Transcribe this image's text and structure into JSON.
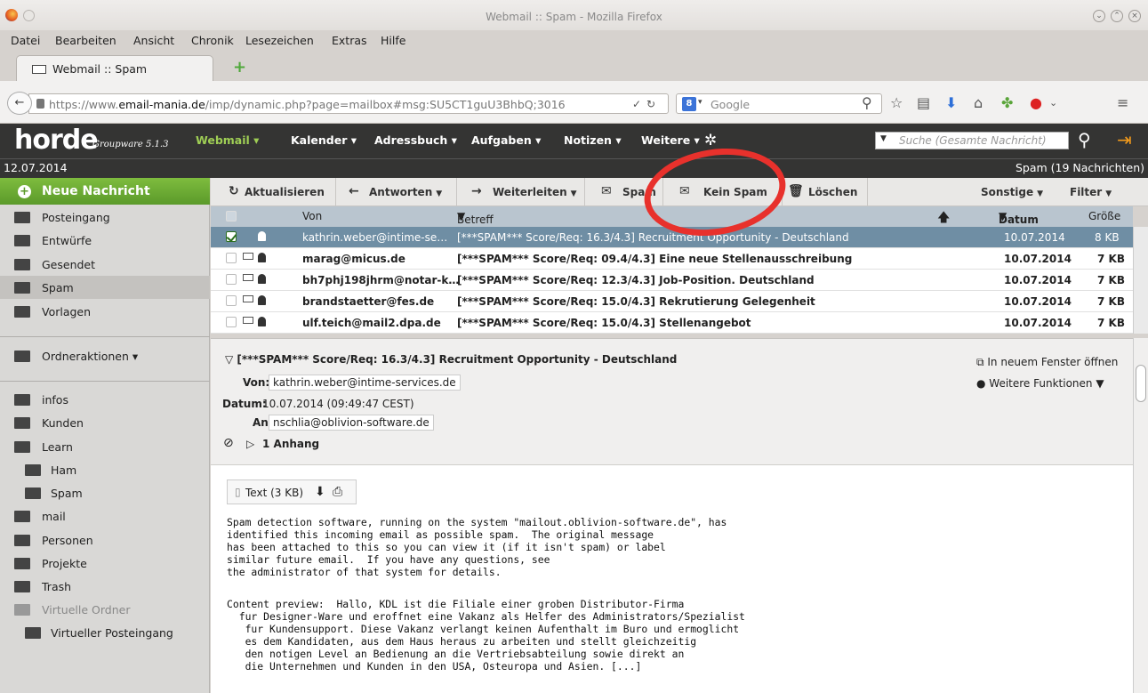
{
  "window": {
    "title": "Webmail :: Spam - Mozilla Firefox"
  },
  "menu": [
    "Datei",
    "Bearbeiten",
    "Ansicht",
    "Chronik",
    "Lesezeichen",
    "Extras",
    "Hilfe"
  ],
  "tab": {
    "label": "Webmail :: Spam"
  },
  "nav": {
    "url_prefix": "https://www.",
    "url_domain": "email-mania.de",
    "url_rest": "/imp/dynamic.php?page=mailbox#msg:SU5CT1guU3BhbQ;3016",
    "search_engine_placeholder": "Google"
  },
  "horde": {
    "logo": "horde",
    "version": "Groupware 5.1.3",
    "nav": [
      "Webmail",
      "Kalender",
      "Adressbuch",
      "Aufgaben",
      "Notizen",
      "Weitere"
    ],
    "search_placeholder": "Suche (Gesamte Nachricht)",
    "date": "12.07.2014",
    "folder_status": "Spam (19 Nachrichten)"
  },
  "sidebar": {
    "new_message": "Neue Nachricht",
    "folders": [
      "Posteingang",
      "Entwürfe",
      "Gesendet",
      "Spam",
      "Vorlagen"
    ],
    "folder_actions": "Ordneraktionen",
    "other_folders": [
      "infos",
      "Kunden",
      "Learn",
      "Ham",
      "Spam",
      "mail",
      "Personen",
      "Projekte",
      "Trash"
    ],
    "virtual_header": "Virtuelle Ordner",
    "virtual_inbox": "Virtueller Posteingang",
    "selected": "Spam"
  },
  "toolbar": {
    "refresh": "Aktualisieren",
    "reply": "Antworten",
    "forward": "Weiterleiten",
    "spam": "Spam",
    "not_spam": "Kein Spam",
    "delete": "Löschen",
    "other": "Sonstige",
    "filter": "Filter"
  },
  "list": {
    "headers": {
      "from": "Von",
      "subject": "Betreff",
      "date": "Datum",
      "size": "Größe"
    },
    "rows": [
      {
        "from": "kathrin.weber@intime-se…",
        "subject": "[***SPAM*** Score/Req: 16.3/4.3] Recruitment Opportunity - Deutschland",
        "date": "10.07.2014",
        "size": "8 KB"
      },
      {
        "from": "marag@micus.de",
        "subject": "[***SPAM*** Score/Req: 09.4/4.3] Eine neue Stellenausschreibung",
        "date": "10.07.2014",
        "size": "7 KB"
      },
      {
        "from": "bh7phj198jhrm@notar-k…",
        "subject": "[***SPAM*** Score/Req: 12.3/4.3] Job-Position. Deutschland",
        "date": "10.07.2014",
        "size": "7 KB"
      },
      {
        "from": "brandstaetter@fes.de",
        "subject": "[***SPAM*** Score/Req: 15.0/4.3] Rekrutierung Gelegenheit",
        "date": "10.07.2014",
        "size": "7 KB"
      },
      {
        "from": "ulf.teich@mail2.dpa.de",
        "subject": "[***SPAM*** Score/Req: 15.0/4.3] Stellenangebot",
        "date": "10.07.2014",
        "size": "7 KB"
      }
    ]
  },
  "preview": {
    "subject": "[***SPAM*** Score/Req: 16.3/4.3] Recruitment Opportunity - Deutschland",
    "from_label": "Von:",
    "from": "kathrin.weber@intime-services.de",
    "date_label": "Datum:",
    "date": "10.07.2014 (09:49:47 CEST)",
    "to_label": "An:",
    "to": "nschlia@oblivion-software.de",
    "attachment_count": "1 Anhang",
    "open_new_window": "In neuem Fenster öffnen",
    "more_functions": "Weitere Funktionen",
    "attachment_label": "Text",
    "attachment_size": "(3 KB)",
    "body_lines": [
      "Spam detection software, running on the system \"mailout.oblivion-software.de\", has",
      "identified this incoming email as possible spam.  The original message",
      "has been attached to this so you can view it (if it isn't spam) or label",
      "similar future email.  If you have any questions, see",
      "the administrator of that system for details.",
      "",
      "Content preview:  Hallo, KDL ist die Filiale einer groben Distributor-Firma",
      "  fur Designer-Ware und eroffnet eine Vakanz als Helfer des Administrators/Spezialist",
      "   fur Kundensupport. Diese Vakanz verlangt keinen Aufenthalt im Buro und ermoglicht",
      "   es dem Kandidaten, aus dem Haus heraus zu arbeiten und stellt gleichzeitig",
      "   den notigen Level an Bedienung an die Vertriebsabteilung sowie direkt an",
      "   die Unternehmen und Kunden in den USA, Osteuropa und Asien. [...]"
    ]
  },
  "colors": {
    "horde_bar": "#343433",
    "new_message_green": "#6aab34",
    "selected_row": "#6f8ea4",
    "annotation_red": "#e8312c"
  }
}
